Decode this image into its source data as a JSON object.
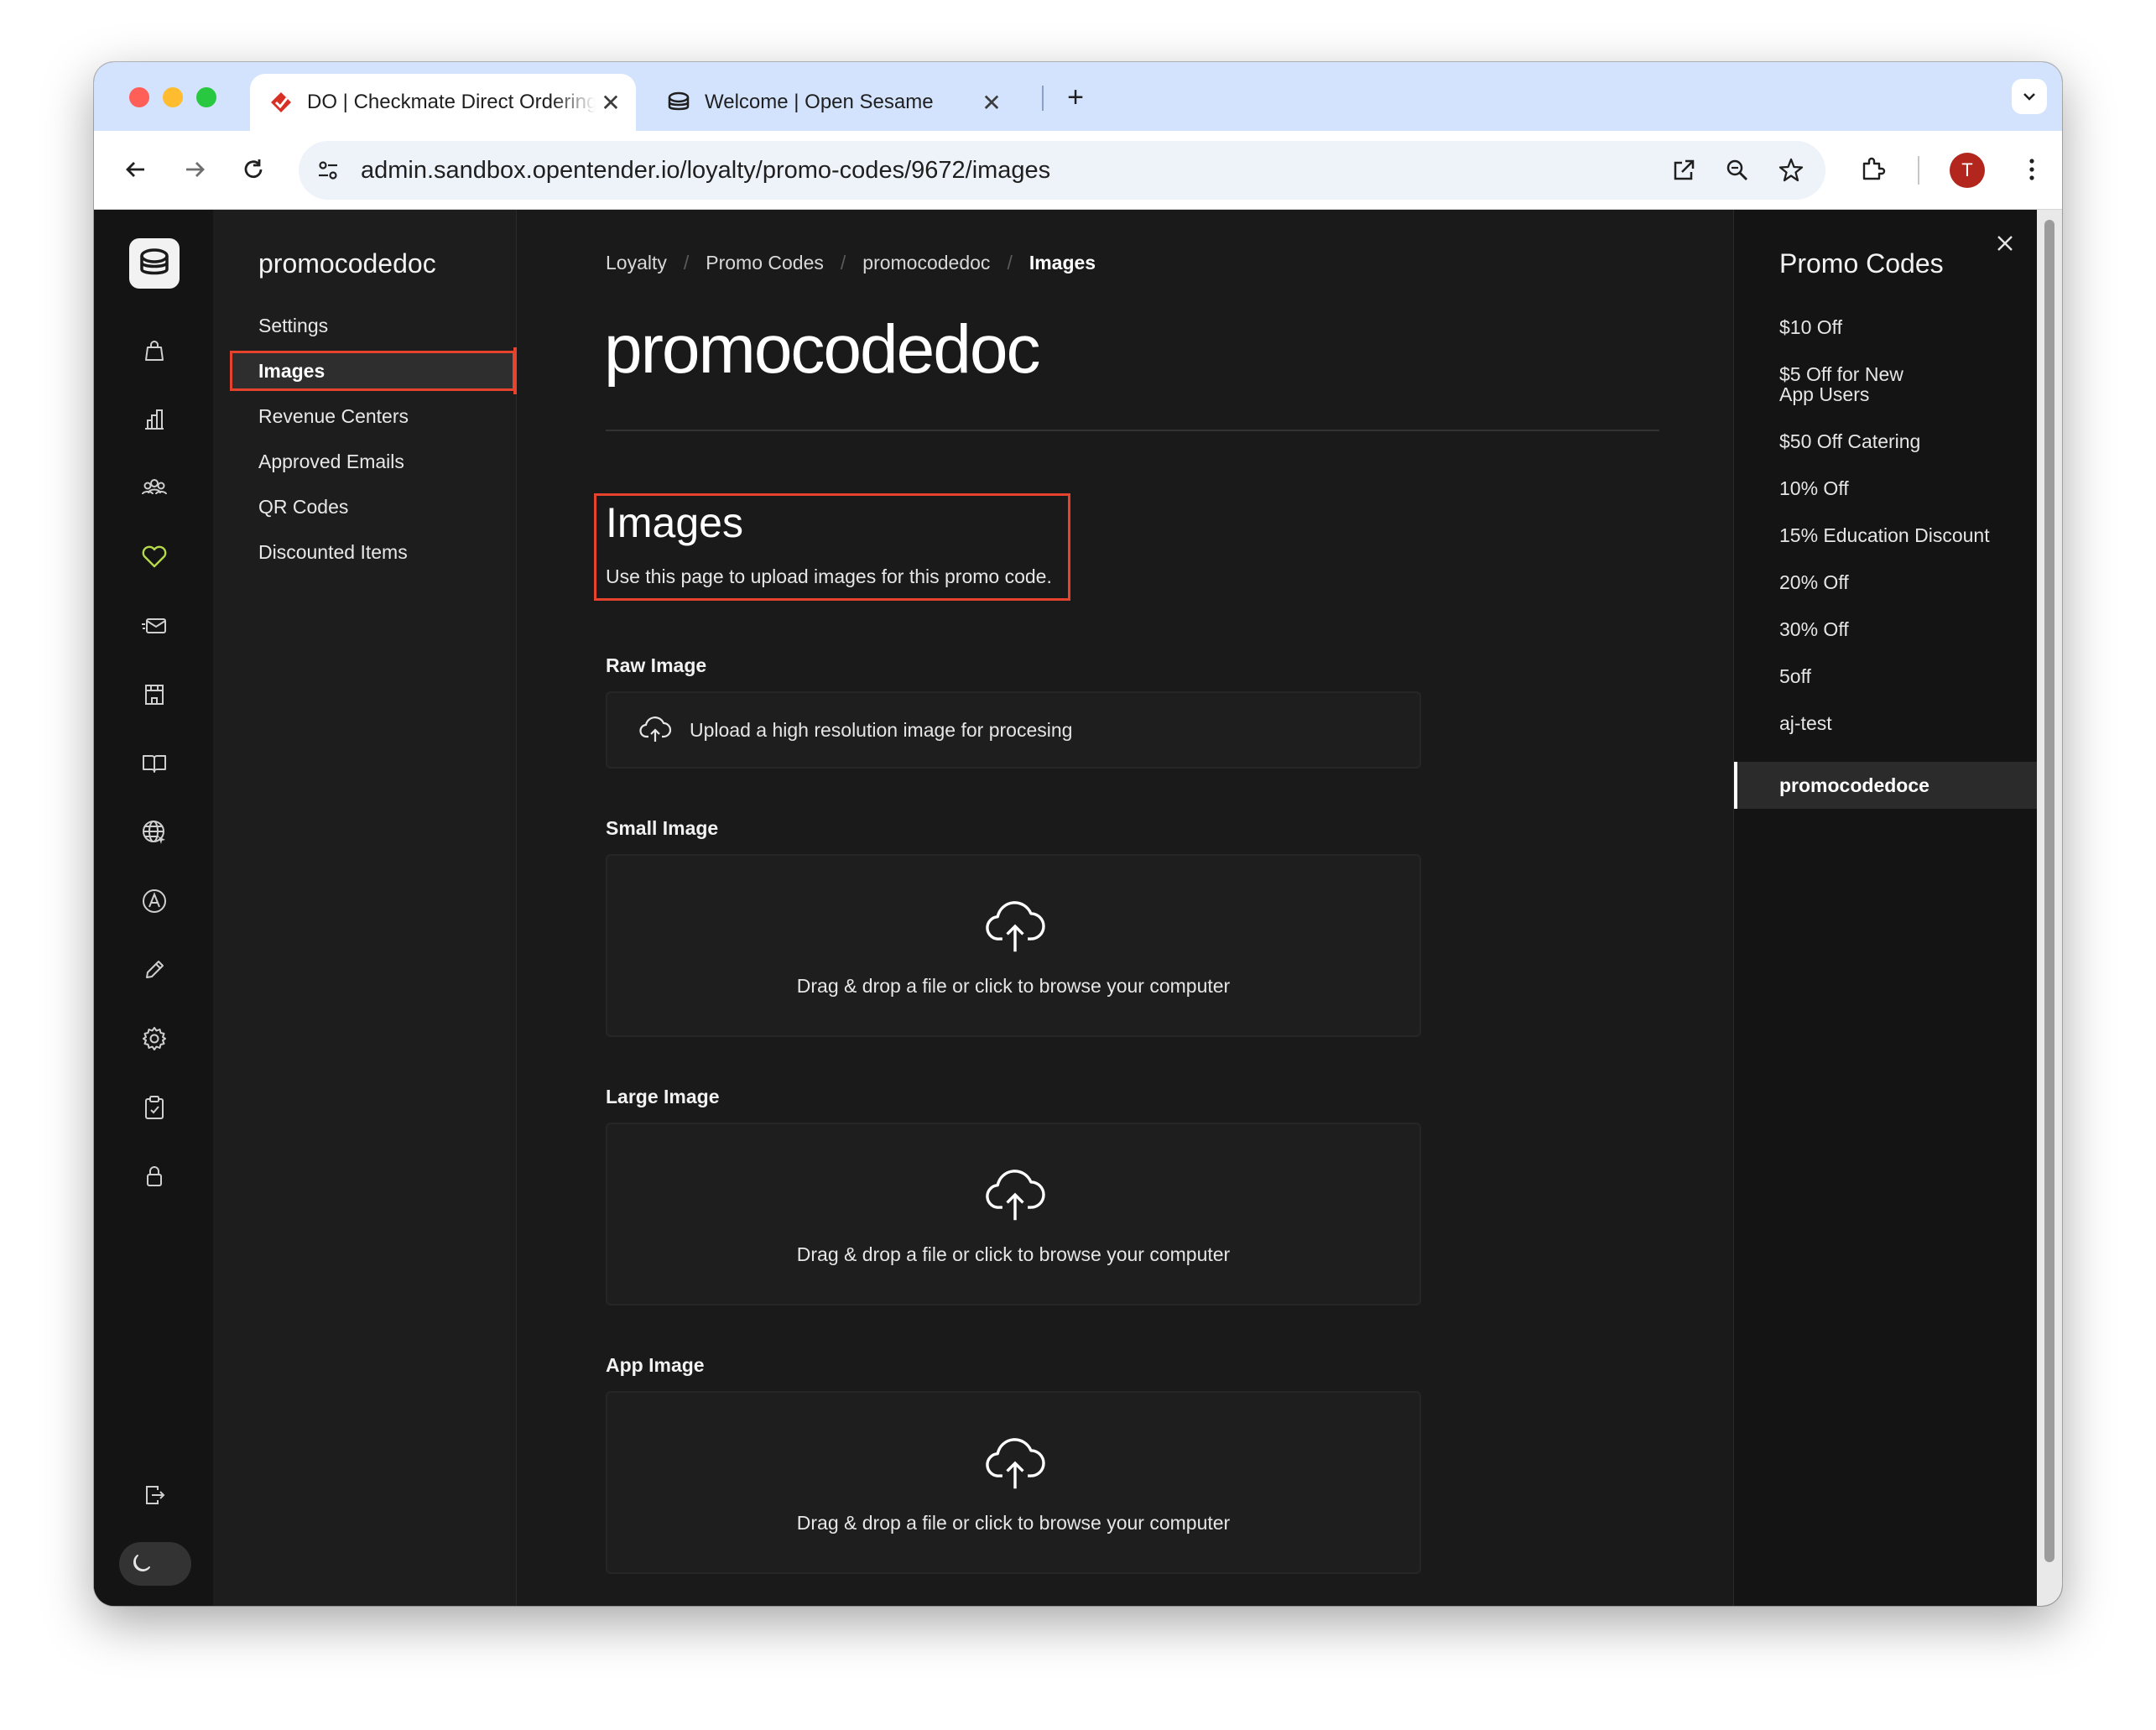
{
  "browser": {
    "tabs": [
      {
        "title": "DO | Checkmate Direct Ordering",
        "close": "✕"
      },
      {
        "title": "Welcome | Open Sesame",
        "close": "✕"
      }
    ],
    "new_tab": "+",
    "url": "admin.sandbox.opentender.io/loyalty/promo-codes/9672/images",
    "profile_initial": "T"
  },
  "subnav": {
    "heading": "promocodedoc",
    "items": [
      {
        "label": "Settings"
      },
      {
        "label": "Images"
      },
      {
        "label": "Revenue Centers"
      },
      {
        "label": "Approved Emails"
      },
      {
        "label": "QR Codes"
      },
      {
        "label": "Discounted Items"
      }
    ]
  },
  "main": {
    "breadcrumb": [
      "Loyalty",
      "Promo Codes",
      "promocodedoc",
      "Images"
    ],
    "breadcrumb_sep": "/",
    "title": "promocodedoc",
    "section_title": "Images",
    "section_desc": "Use this page to upload images for this promo code.",
    "raw_image": {
      "label": "Raw Image",
      "text": "Upload a high resolution image for procesing"
    },
    "small_image": {
      "label": "Small Image",
      "text": "Drag & drop a file or click to browse your computer"
    },
    "large_image": {
      "label": "Large Image",
      "text": "Drag & drop a file or click to browse your computer"
    },
    "app_image": {
      "label": "App Image",
      "text": "Drag & drop a file or click to browse your computer"
    }
  },
  "right_panel": {
    "heading": "Promo Codes",
    "items": [
      {
        "label": "$10 Off"
      },
      {
        "label": "$5 Off for New App Users"
      },
      {
        "label": "$50 Off Catering"
      },
      {
        "label": "10% Off"
      },
      {
        "label": "15% Education Discount"
      },
      {
        "label": "20% Off"
      },
      {
        "label": "30% Off"
      },
      {
        "label": "5off"
      },
      {
        "label": "aj-test"
      },
      {
        "label": "promocodedoce"
      }
    ]
  },
  "colors": {
    "accent_highlight": "#e5432d",
    "nav_active_heart": "#b6d94c",
    "background": "#1a1a1a"
  }
}
